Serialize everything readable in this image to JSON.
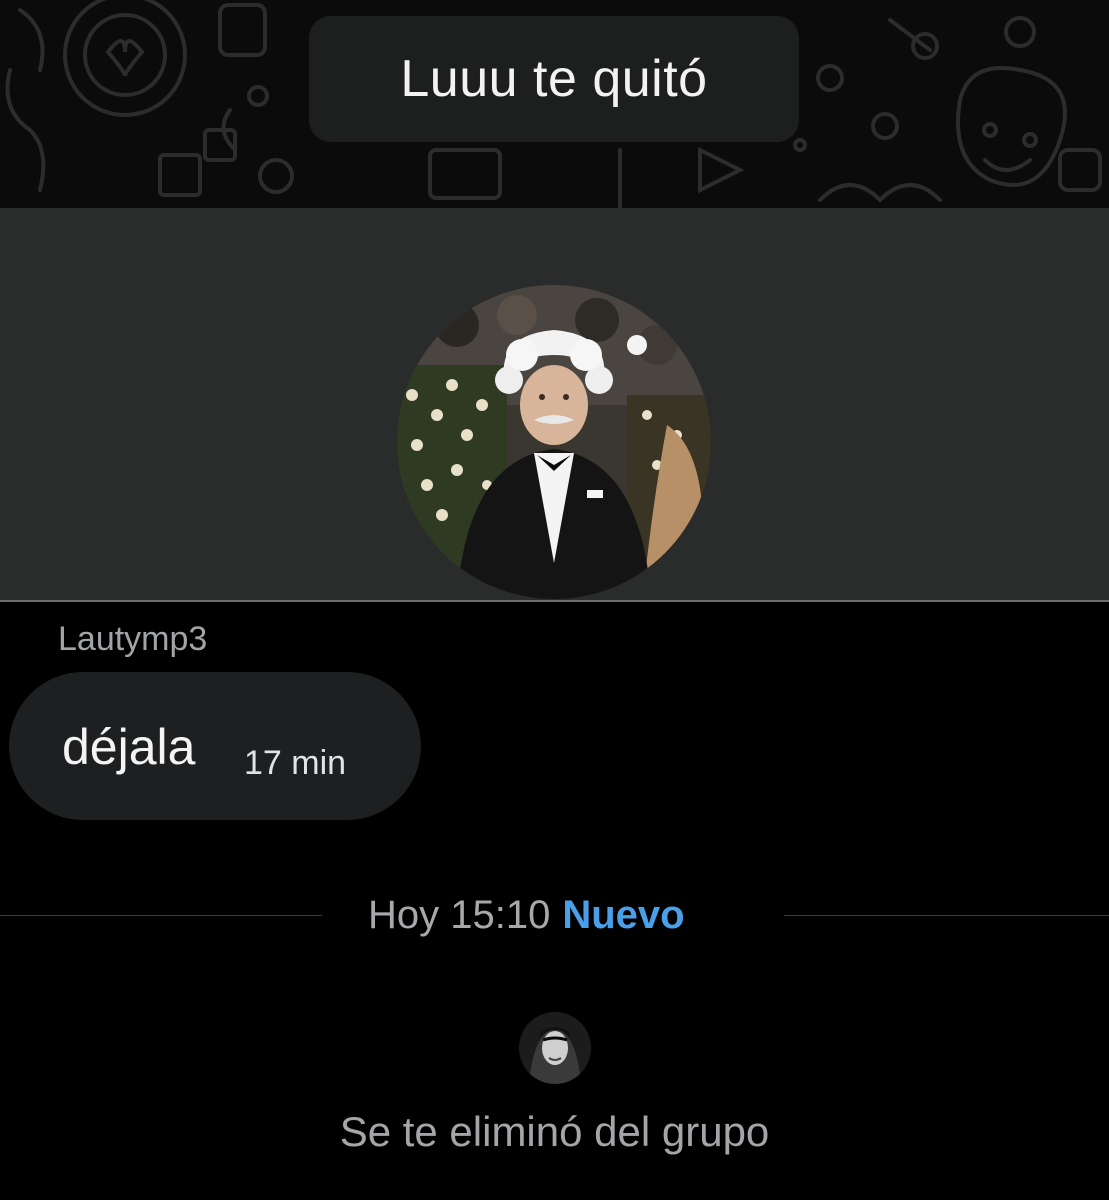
{
  "top_banner": {
    "text": "Luuu te quitó"
  },
  "group_info": {
    "avatar_icon": "group-avatar-photo"
  },
  "message": {
    "sender": "Lautymp3",
    "text": "déjala",
    "time": "17 min"
  },
  "date_separator": {
    "label": "Hoy 15:10",
    "new_label": "Nuevo",
    "new_color": "#4a9fe8"
  },
  "system_event": {
    "avatar_icon": "user-avatar-photo",
    "text": "Se te eliminó del grupo"
  },
  "colors": {
    "background": "#000000",
    "panel": "#2a2b2b",
    "bubble": "#1d1f21",
    "muted_text": "#a3a5a8"
  }
}
